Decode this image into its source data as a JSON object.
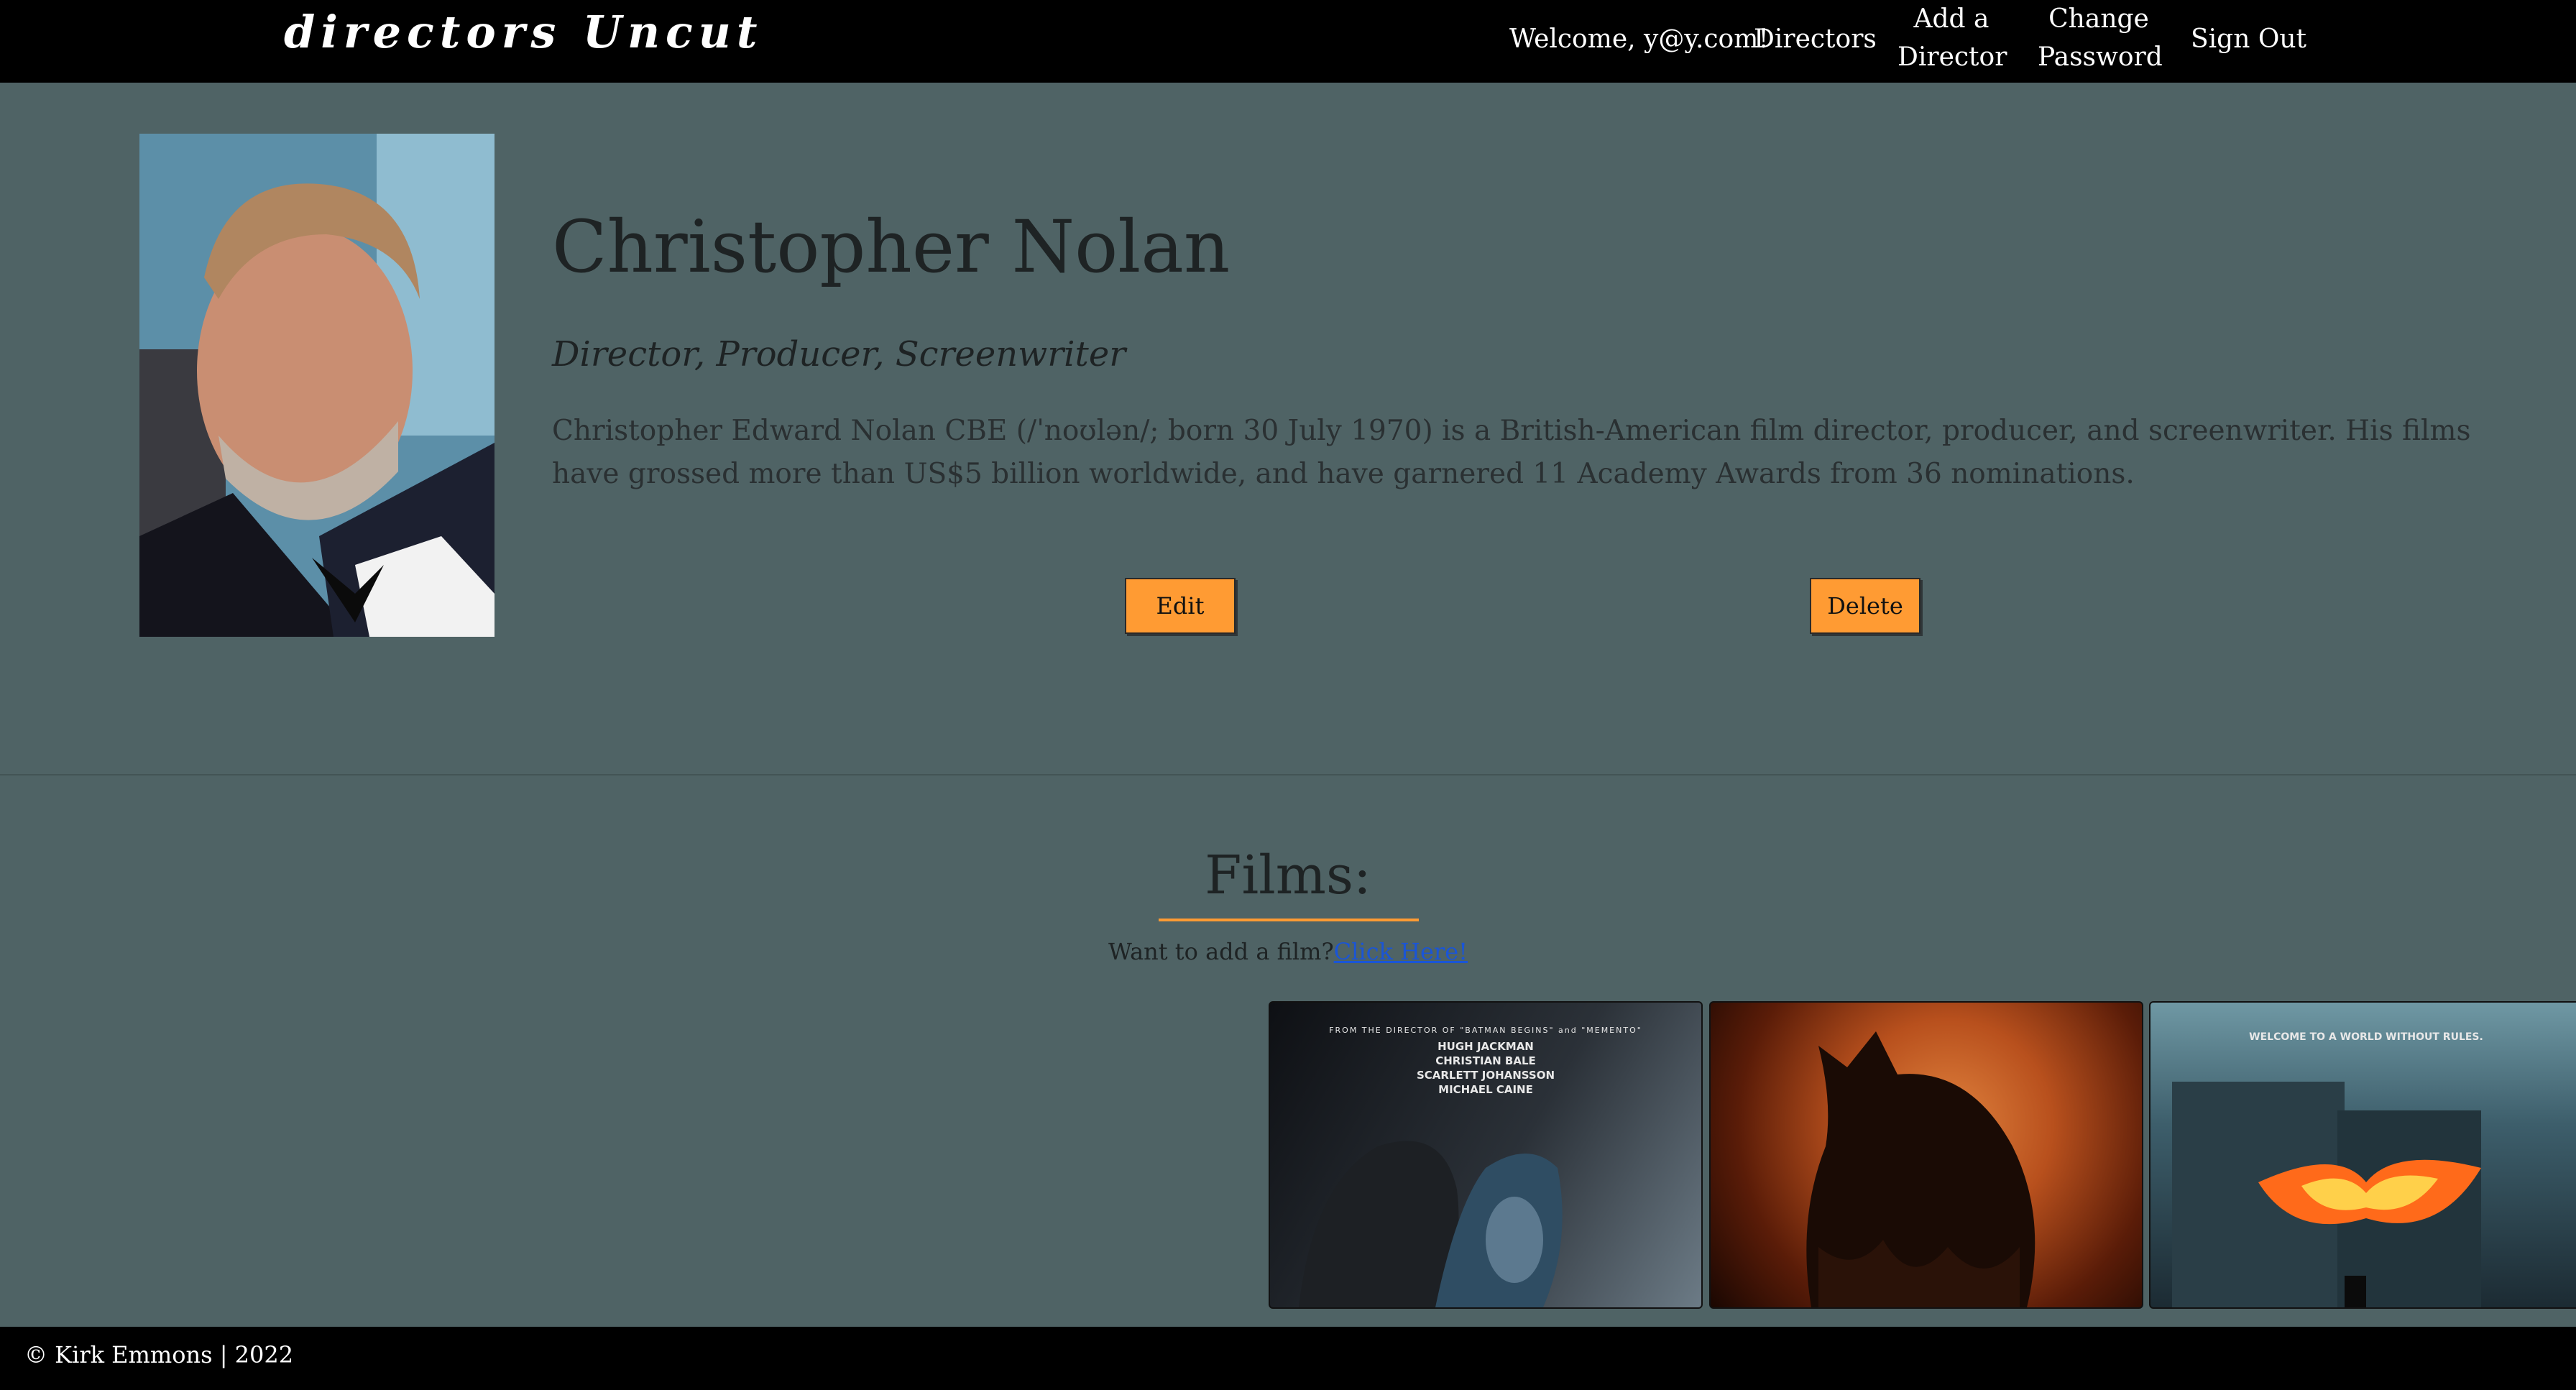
{
  "nav": {
    "brand": "directors Uncut",
    "welcome": "Welcome, y@y.com!",
    "directors": "Directors",
    "add_director_line1": "Add a",
    "add_director_line2": "Director",
    "change_password_line1": "Change",
    "change_password_line2": "Password",
    "sign_out": "Sign Out"
  },
  "director": {
    "name": "Christopher Nolan",
    "roles": "Director, Producer, Screenwriter",
    "bio": "Christopher Edward Nolan CBE (/ˈnoʊlən/; born 30 July 1970) is a British-American film director, producer, and screenwriter. His films have grossed more than US$5 billion worldwide, and have garnered 11 Academy Awards from 36 nominations.",
    "edit_label": "Edit",
    "delete_label": "Delete"
  },
  "films": {
    "heading": "Films:",
    "add_prompt": "Want to add a film?",
    "add_link": "Click Here!",
    "posters": [
      {
        "tagline": "FROM THE DIRECTOR OF \"BATMAN BEGINS\" and \"MEMENTO\"",
        "credits": [
          "HUGH JACKMAN",
          "CHRISTIAN BALE",
          "SCARLETT JOHANSSON",
          "MICHAEL CAINE"
        ]
      },
      {
        "tagline": ""
      },
      {
        "tagline": "WELCOME TO A WORLD WITHOUT RULES."
      }
    ]
  },
  "footer": {
    "text": "© Kirk Emmons | 2022"
  },
  "colors": {
    "background": "#4f6365",
    "navbar": "#000000",
    "accent": "#ff9b33",
    "link": "#1a55d6"
  }
}
